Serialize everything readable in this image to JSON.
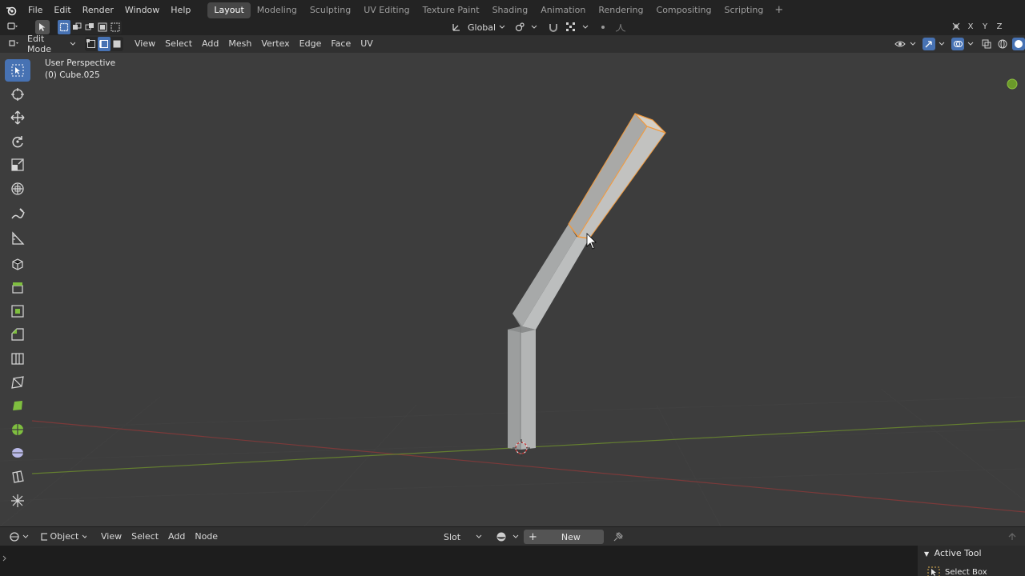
{
  "menu": {
    "items": [
      "File",
      "Edit",
      "Render",
      "Window",
      "Help"
    ]
  },
  "workspaces": {
    "tabs": [
      "Layout",
      "Modeling",
      "Sculpting",
      "UV Editing",
      "Texture Paint",
      "Shading",
      "Animation",
      "Rendering",
      "Compositing",
      "Scripting"
    ],
    "active": "Layout",
    "add_label": "+"
  },
  "tool_settings": {
    "transform_orientation": "Global"
  },
  "viewport_header": {
    "mode": "Edit Mode",
    "menus": [
      "View",
      "Select",
      "Add",
      "Mesh",
      "Vertex",
      "Edge",
      "Face",
      "UV"
    ]
  },
  "viewport": {
    "perspective_label": "User Perspective",
    "object_label": "(0) Cube.025"
  },
  "shader_header": {
    "mode": "Object",
    "menus": [
      "View",
      "Select",
      "Add",
      "Node"
    ],
    "slot": "Slot",
    "new_label": "New"
  },
  "active_tool_panel": {
    "title": "Active Tool",
    "tool_name": "Select Box"
  },
  "colors": {
    "accent": "#4772b3",
    "selection": "#f29a3d",
    "grid_x": "#8b3a3a",
    "grid_y": "#6b8a2e",
    "viewport_bg": "#3d3d3d"
  }
}
